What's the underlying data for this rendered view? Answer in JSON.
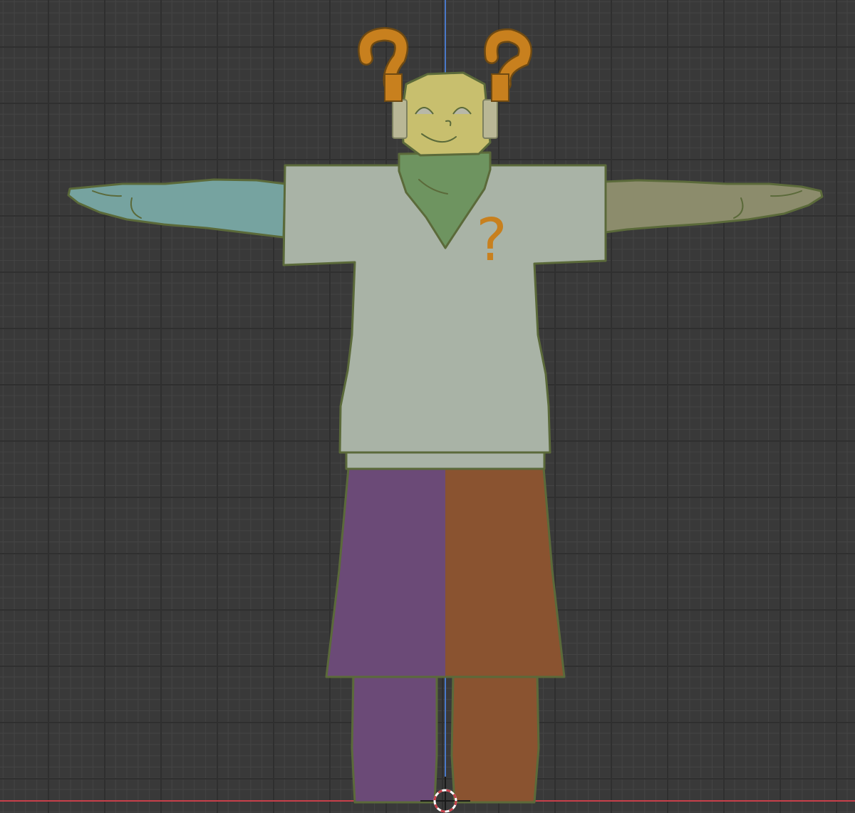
{
  "viewport": {
    "type": "3d-viewport-front-orthographic",
    "grid": true
  },
  "scene": {
    "object": "t-pose-character-model",
    "colors": {
      "background": "#393939",
      "skin": "#c8bf6e",
      "shirt": "#a9b3a6",
      "scarf": "#6e9460",
      "left_arm": "#76a3a0",
      "right_arm": "#8c8c6c",
      "left_pants": "#6b4a77",
      "right_pants": "#8a5330",
      "horns": "#c8801e",
      "outline": "#5b6a3a",
      "axis_z": "#4a78c8",
      "axis_x": "#c8404a"
    },
    "shirt_emblem": "?",
    "icons": [
      "question-mark-horn-left",
      "question-mark-horn-right",
      "question-mark-emblem",
      "3d-cursor-icon"
    ]
  }
}
